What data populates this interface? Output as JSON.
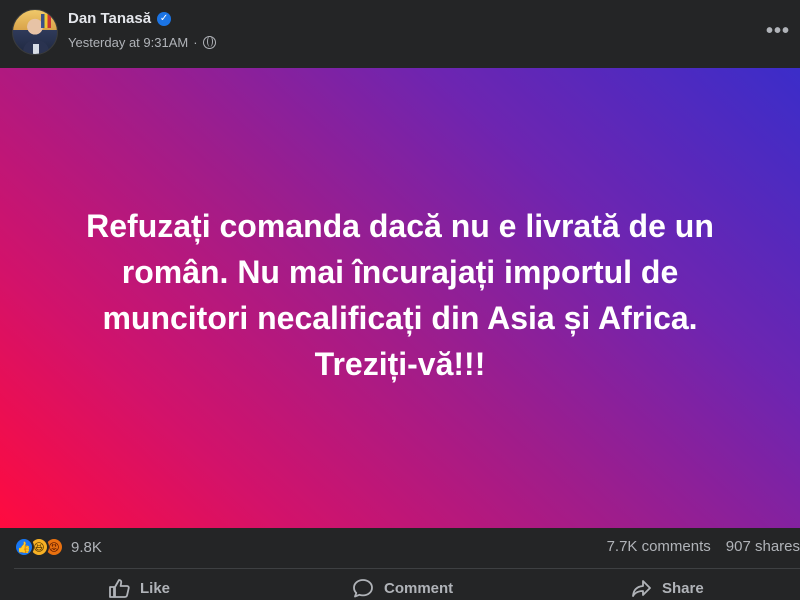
{
  "post": {
    "author": "Dan Tanasă",
    "time": "Yesterday at 9:31AM",
    "separator": "·",
    "more": "•••",
    "lines": [
      "Refuzați comanda dacă nu e livrată de un",
      "român. Nu mai încurajați importul de",
      "muncitori necalificați din Asia și Africa.",
      "Treziți-vă!!!"
    ]
  },
  "stats": {
    "reactions": "9.8K",
    "comments": "7.7K comments",
    "shares": "907 shares"
  },
  "actions": {
    "like": "Like",
    "comment": "Comment",
    "share": "Share"
  },
  "icons": {
    "verified": "verified-badge-icon",
    "globe": "globe-icon",
    "like": "thumbs-up-icon",
    "comment": "comment-bubble-icon",
    "share": "share-arrow-icon"
  },
  "colors": {
    "background": "#242526",
    "accent": "#1877f2",
    "gradient_start": "#ff0b3f",
    "gradient_end": "#3b2dc9"
  }
}
